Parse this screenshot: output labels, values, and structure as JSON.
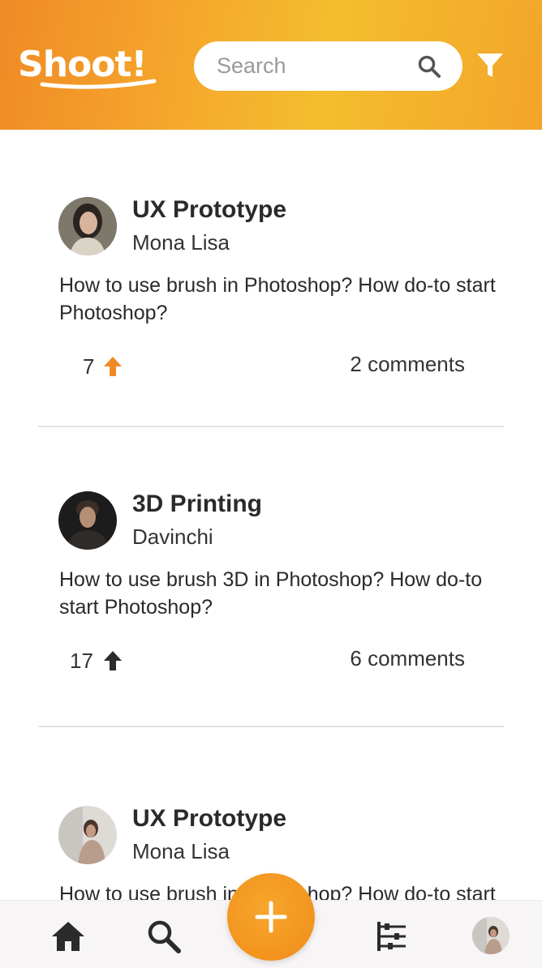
{
  "app": {
    "name": "Shoot!"
  },
  "search": {
    "placeholder": "Search"
  },
  "posts": [
    {
      "title": "UX Prototype",
      "author": "Mona Lisa",
      "body": "How to use brush in Photoshop? How do-to start Photoshop?",
      "votes": "7",
      "vote_color": "#f08a24",
      "comments": "2 comments"
    },
    {
      "title": "3D Printing",
      "author": "Davinchi",
      "body": "How to use brush 3D in Photoshop? How do-to start Photoshop?",
      "votes": "17",
      "vote_color": "#2b2b2b",
      "comments": "6 comments"
    },
    {
      "title": "UX Prototype",
      "author": "Mona Lisa",
      "body": "How to use brush in Photoshop? How do-to start Photoshop?"
    }
  ],
  "nav": {
    "items": [
      "home-icon",
      "search-icon",
      "add-icon",
      "sliders-icon",
      "profile-avatar"
    ]
  },
  "colors": {
    "accent": "#f39a22",
    "header_start": "#f08a25",
    "header_mid": "#f4bd2f"
  }
}
